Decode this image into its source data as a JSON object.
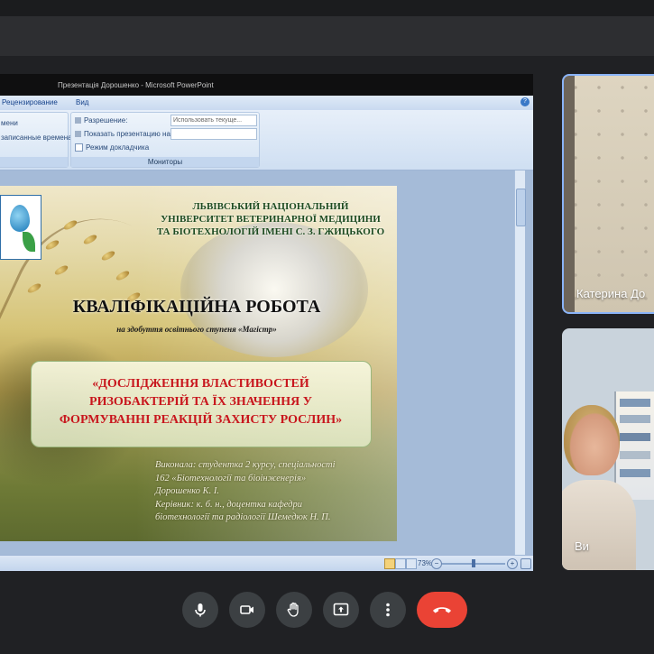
{
  "window": {
    "title": "Презентація Дорошенко - Microsoft PowerPoint"
  },
  "ribbon": {
    "tabs": [
      "Рецензирование",
      "Вид"
    ],
    "left_group": {
      "item1": "мени",
      "item2": "записанные времена"
    },
    "monitors_group": {
      "label": "Мониторы",
      "resolution_label": "Разрешение:",
      "resolution_value": "Использовать текуще...",
      "show_on_label": "Показать презентацию на:",
      "presenter_mode_label": "Режим докладчика"
    }
  },
  "status": {
    "zoom": "73%"
  },
  "slide": {
    "university": [
      "ЛЬВІВСЬКИЙ НАЦІОНАЛЬНИЙ",
      "УНІВЕРСИТЕТ ВЕТЕРИНАРНОЇ МЕДИЦИНИ",
      "ТА БІОТЕХНОЛОГІЙ ІМЕНІ С. З. ГЖИЦЬКОГО"
    ],
    "heading": "КВАЛІФІКАЦІЙНА РОБОТА",
    "degree": "на здобуття освітнього ступеня «Магістр»",
    "topic": [
      "«ДОСЛІДЖЕННЯ ВЛАСТИВОСТЕЙ",
      "РИЗОБАКТЕРІЙ ТА ЇХ ЗНАЧЕННЯ У",
      "ФОРМУВАННІ РЕАКЦІЙ ЗАХИСТУ РОСЛИН»"
    ],
    "info": [
      "Виконала: студентка 2 курсу, спеціальності",
      "162 «Біотехнології та біоінженерія»",
      "Дорошенко К. І.",
      "Керівник: к. б. н., доцентка кафедри",
      "біотехнології та радіології  Шемедюк Н. П."
    ]
  },
  "participants": [
    {
      "name": "Катерина До"
    },
    {
      "name": "Ви"
    }
  ],
  "controls": {
    "icons": [
      "microphone-icon",
      "camera-icon",
      "raise-hand-icon",
      "present-screen-icon",
      "more-options-icon",
      "end-call-icon"
    ],
    "end_call_color": "#ea4335",
    "active_speaker_border": "#8ab4f8"
  }
}
